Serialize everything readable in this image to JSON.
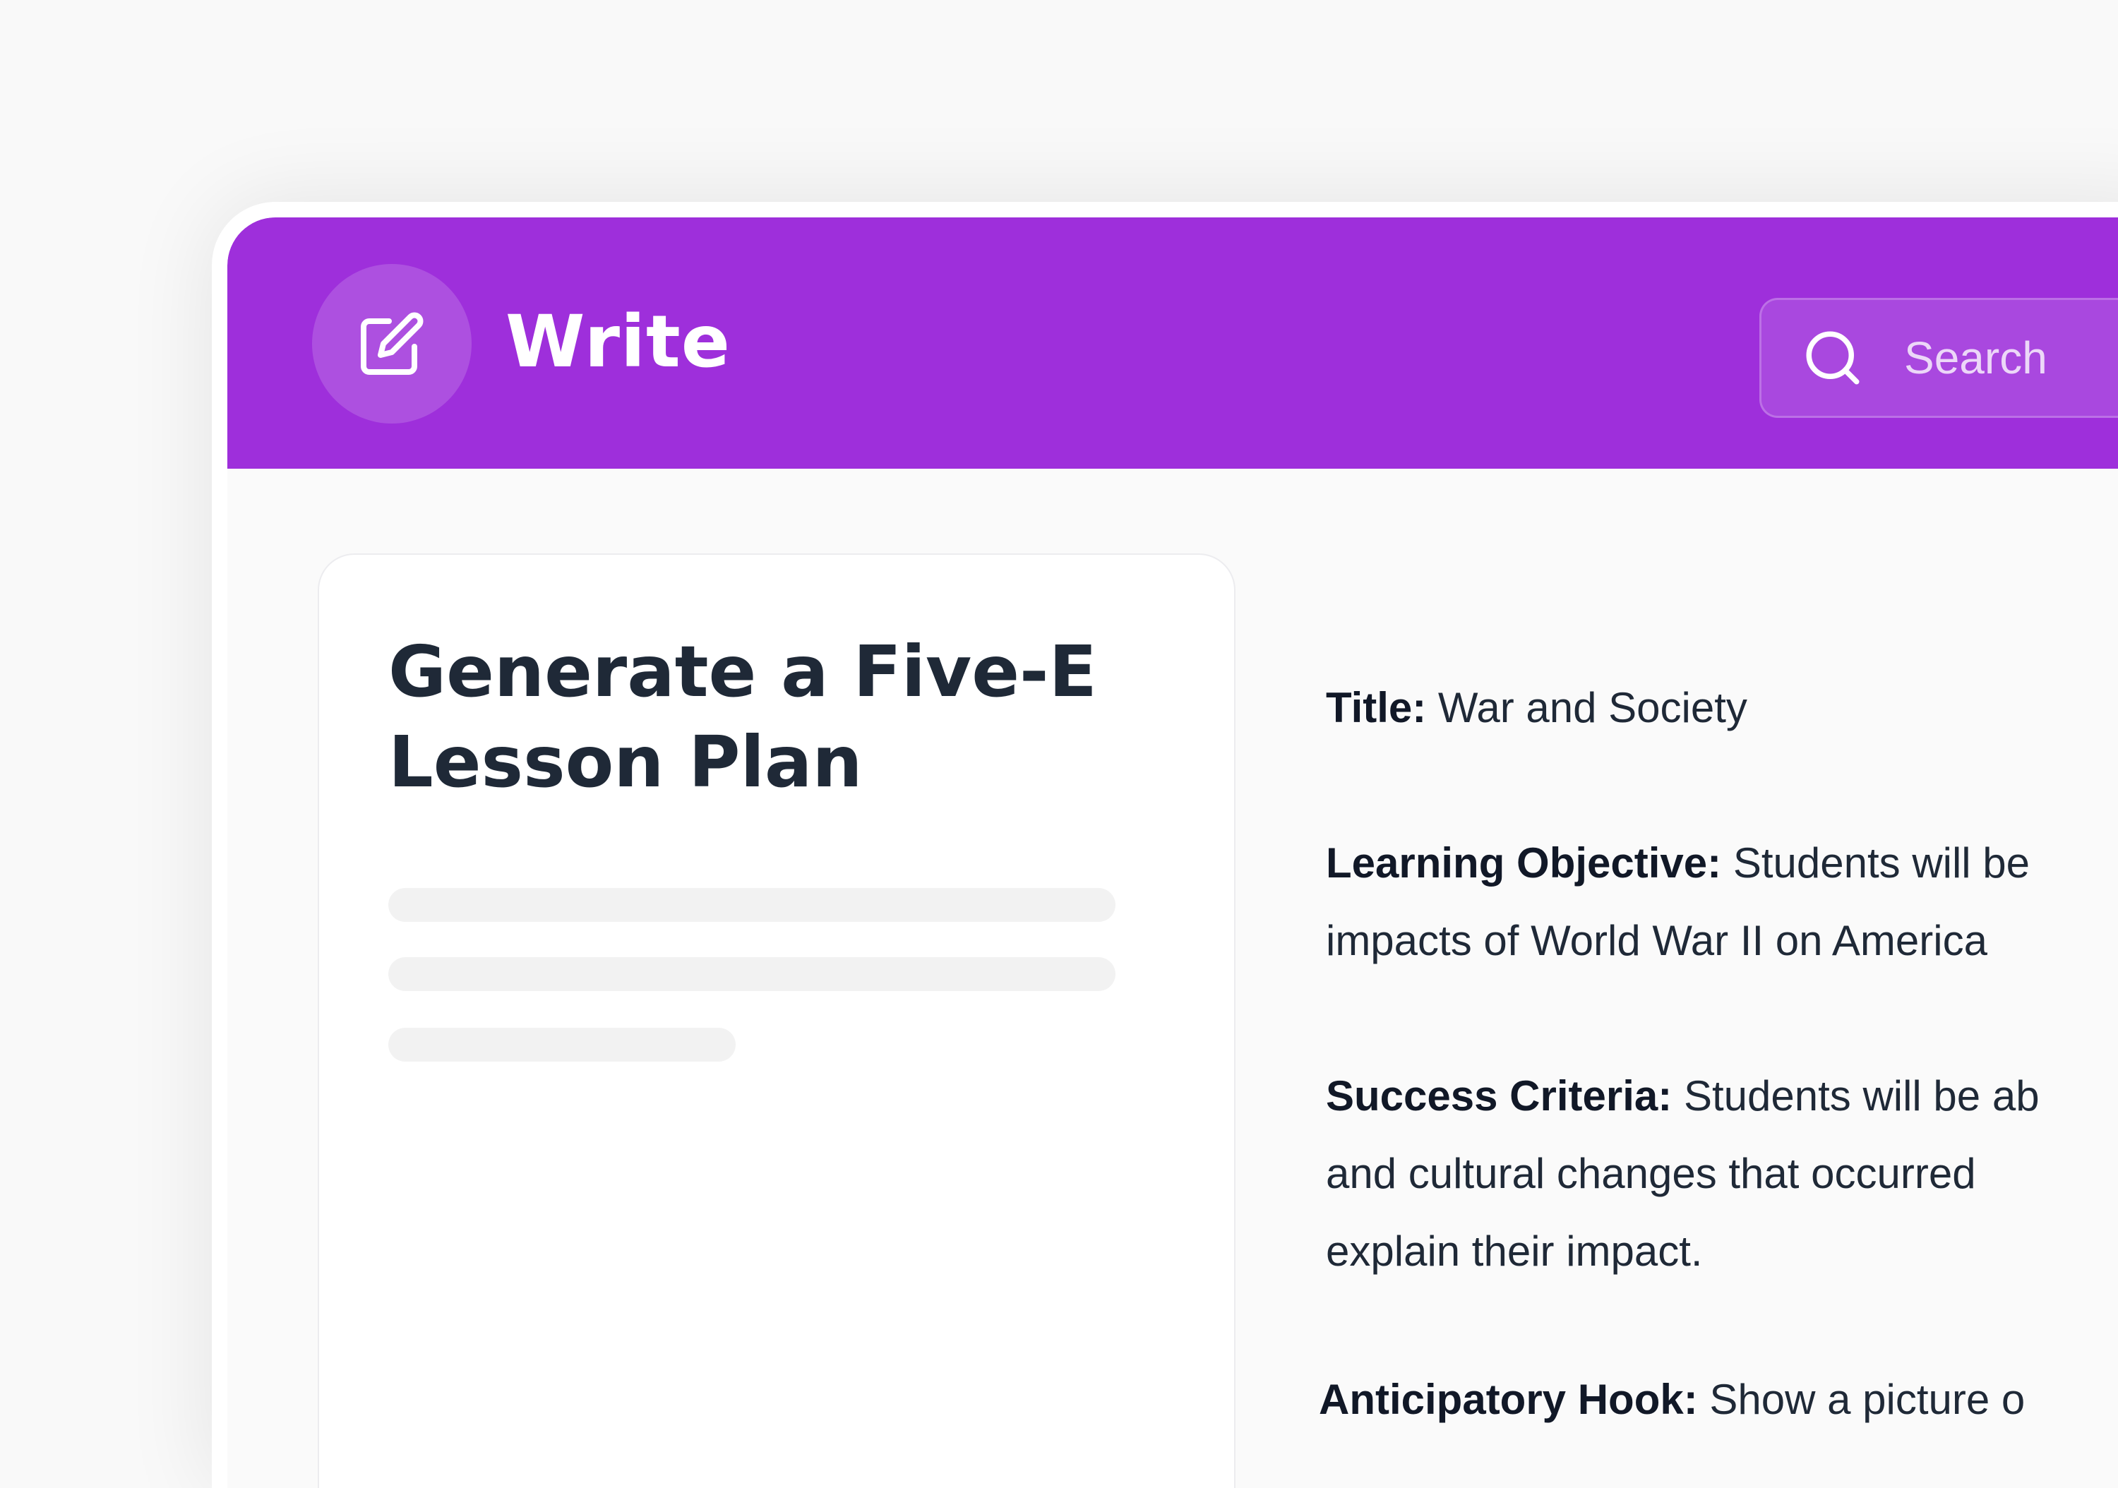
{
  "header": {
    "app_icon": "edit-icon",
    "title": "Write",
    "search": {
      "icon": "search-icon",
      "placeholder": "Search"
    },
    "background_color": "#9e2fdb"
  },
  "card": {
    "title": "Generate a Five-E Lesson Plan",
    "loading_lines": 3
  },
  "output": {
    "sections": [
      {
        "label": "Title:",
        "text": "War and Society"
      },
      {
        "label": "Learning Objective:",
        "text": "Students will be",
        "text2": "impacts of World War II on America"
      },
      {
        "label": "Success Criteria:",
        "text": "Students will be ab",
        "text2": "and cultural changes that occurred",
        "text3": "explain their impact."
      },
      {
        "label": "Anticipatory Hook:",
        "text": "Show a picture o"
      }
    ]
  }
}
